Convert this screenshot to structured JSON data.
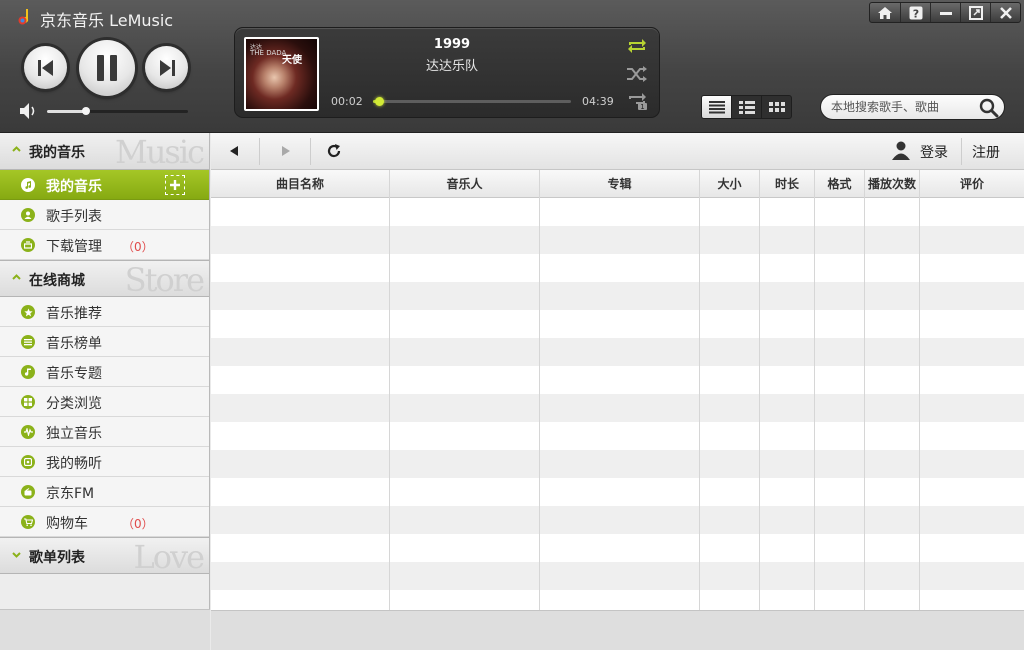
{
  "app": {
    "title": "京东音乐 LeMusic"
  },
  "window_controls": {
    "home": "home-icon",
    "help": "help-icon",
    "minimize": "minimize-icon",
    "maximize": "maximize-icon",
    "close": "close-icon"
  },
  "player": {
    "song_title": "1999",
    "artist": "达达乐队",
    "time_current": "00:02",
    "time_total": "04:39",
    "progress_fraction": 0.03,
    "volume_fraction": 0.28,
    "album_art": {
      "line1": "达达",
      "line2": "THE DADA",
      "title": "天使"
    }
  },
  "search": {
    "placeholder": "本地搜索歌手、歌曲"
  },
  "sidebar": {
    "sections": [
      {
        "title": "我的音乐",
        "watermark": "Music",
        "expanded": true
      },
      {
        "title": "在线商城",
        "watermark": "Store",
        "expanded": true
      },
      {
        "title": "歌单列表",
        "watermark": "Love",
        "expanded": false
      }
    ],
    "my_music": [
      {
        "label": "我的音乐",
        "count": "",
        "active": true
      },
      {
        "label": "歌手列表",
        "count": ""
      },
      {
        "label": "下载管理",
        "count": "（0）"
      }
    ],
    "store": [
      {
        "label": "音乐推荐",
        "count": ""
      },
      {
        "label": "音乐榜单",
        "count": ""
      },
      {
        "label": "音乐专题",
        "count": ""
      },
      {
        "label": "分类浏览",
        "count": ""
      },
      {
        "label": "独立音乐",
        "count": ""
      },
      {
        "label": "我的畅听",
        "count": ""
      },
      {
        "label": "京东FM",
        "count": ""
      },
      {
        "label": "购物车",
        "count": "（0）"
      }
    ]
  },
  "toolbar": {
    "login": "登录",
    "register": "注册"
  },
  "table": {
    "columns": [
      "曲目名称",
      "音乐人",
      "专辑",
      "大小",
      "时长",
      "格式",
      "播放次数",
      "评价"
    ],
    "rows": []
  },
  "colors": {
    "accent": "#9cbf1e",
    "active_nav": "#95b81a",
    "count": "#e04a4a"
  }
}
